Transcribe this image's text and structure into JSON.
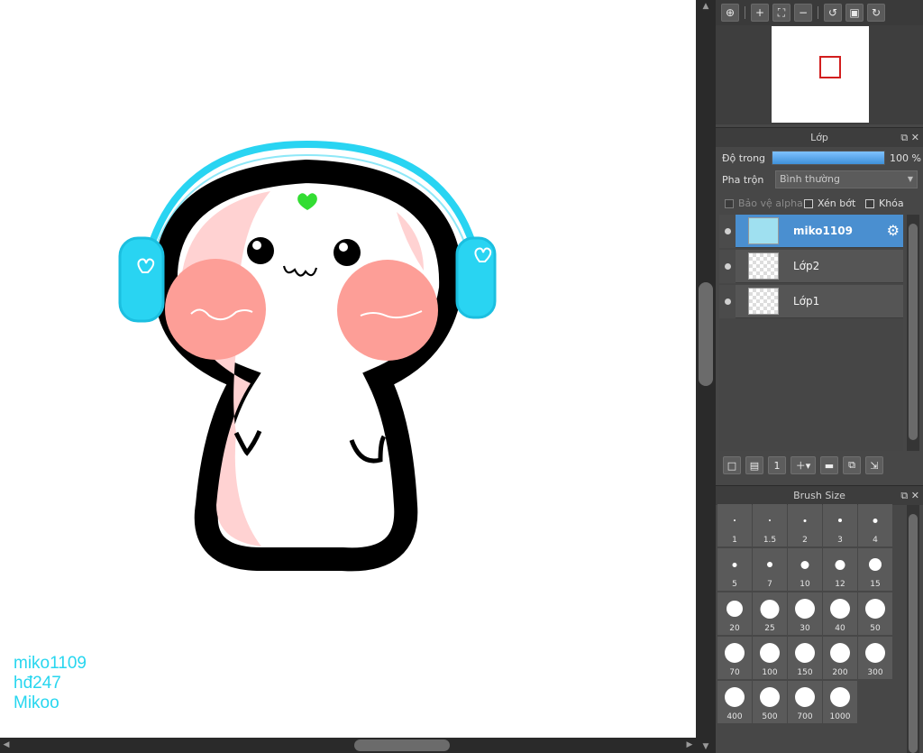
{
  "canvas": {
    "watermark": [
      "miko1109",
      "hđ247",
      "Mikoo"
    ]
  },
  "navigator": {
    "tools": [
      "zoom-fit-icon",
      "zoom-in-icon",
      "fit-screen-icon",
      "zoom-out-icon",
      "rotate-left-icon",
      "fullscreen-icon",
      "rotate-right-icon"
    ]
  },
  "layer_panel": {
    "title": "Lớp",
    "opacity_label": "Độ trong",
    "opacity_value": "100 %",
    "opacity_fraction": 1.0,
    "blend_label": "Pha trộn",
    "blend_value": "Bình thường",
    "protect_alpha": "Bảo vệ alpha",
    "clipping": "Xén bớt",
    "lock": "Khóa",
    "layers": [
      {
        "name": "miko1109",
        "active": true
      },
      {
        "name": "Lớp2",
        "active": false
      },
      {
        "name": "Lớp1",
        "active": false
      }
    ]
  },
  "brush_panel": {
    "title": "Brush Size",
    "sizes": [
      "1",
      "1.5",
      "2",
      "3",
      "4",
      "5",
      "7",
      "10",
      "12",
      "15",
      "20",
      "25",
      "30",
      "40",
      "50",
      "70",
      "100",
      "150",
      "200",
      "300",
      "400",
      "500",
      "700",
      "1000"
    ]
  },
  "colors": {
    "accent": "#4a8fd0",
    "watermark": "#27d6ef",
    "headphones": "#29d4f2",
    "blush": "#fd9e97"
  }
}
